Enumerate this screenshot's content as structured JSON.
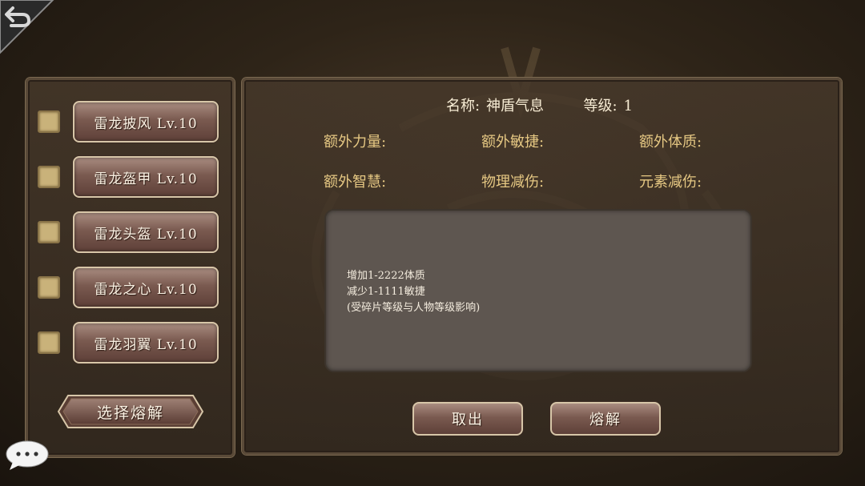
{
  "items": [
    {
      "label": "雷龙披风 Lv.10",
      "checked": false
    },
    {
      "label": "雷龙盔甲 Lv.10",
      "checked": false
    },
    {
      "label": "雷龙头盔 Lv.10",
      "checked": false
    },
    {
      "label": "雷龙之心 Lv.10",
      "checked": false
    },
    {
      "label": "雷龙羽翼 Lv.10",
      "checked": false
    }
  ],
  "select_melt_label": "选择熔解",
  "detail": {
    "name_label": "名称:",
    "name_value": "神盾气息",
    "level_label": "等级:",
    "level_value": "1",
    "stats": [
      "额外力量:",
      "额外敏捷:",
      "额外体质:",
      "额外智慧:",
      "物理减伤:",
      "元素减伤:"
    ],
    "description": [
      "增加1-2222体质",
      "减少1-1111敏捷",
      "(受碎片等级与人物等级影响)"
    ]
  },
  "buttons": {
    "cancel": "取出",
    "melt": "熔解"
  },
  "icons": {
    "back": "back-arrow-icon",
    "chat": "chat-bubble-icon"
  },
  "colors": {
    "accent": "#e6c883",
    "button": "#7a5a50"
  }
}
